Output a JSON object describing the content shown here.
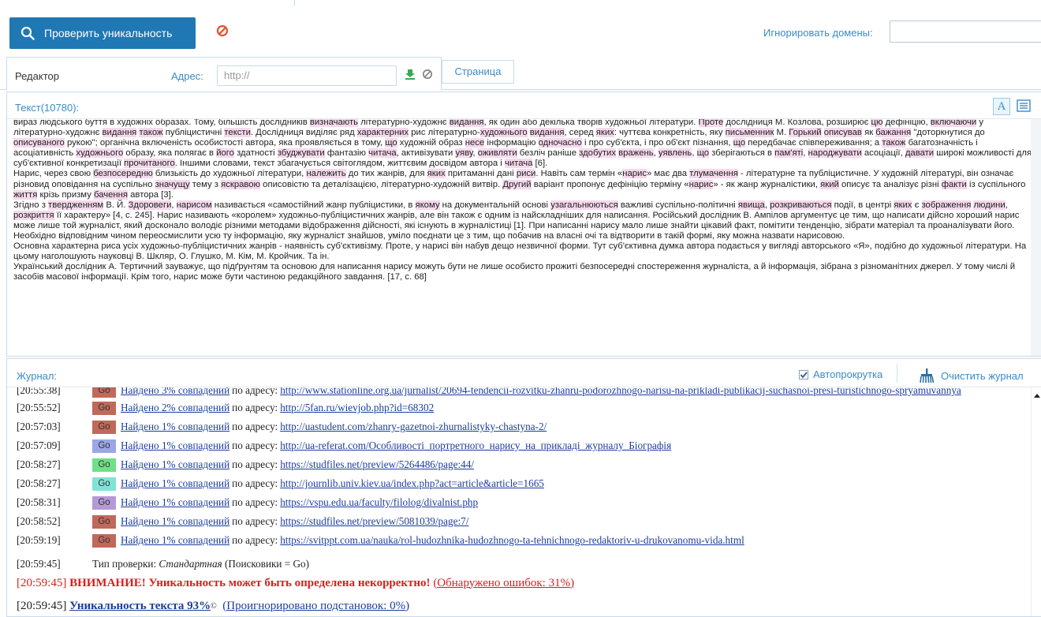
{
  "toolbar": {
    "check_label": "Проверить уникальность",
    "ignore_domains_label": "Игнорировать домены:",
    "ignore_domains_value": ""
  },
  "editor": {
    "tab_label": "Редактор",
    "address_label": "Адрес:",
    "address_placeholder": "http://",
    "page_tab_label": "Страница"
  },
  "text_panel": {
    "title": "Текст(10780):",
    "font_icon_glyph": "A"
  },
  "journal": {
    "title": "Журнал:",
    "autoscroll_label": "Автопрокрутка",
    "autoscroll_checked": true,
    "clear_label": "Очистить журнал",
    "match_prefix_by": "по адресу:",
    "rows": [
      {
        "time": "[20:55:38]",
        "go": "Go",
        "go_color": "#c0695a",
        "match": "Найдено 3% совпадений",
        "url": "http://www.stationline.org.ua/jurnalist/20694-tendencii-rozvitku-zhanru-podorozhnogo-narisu-na-prikladi-publikacij-suchasnoi-presi-turistichnogo-spryamuvannya"
      },
      {
        "time": "[20:55:52]",
        "go": "Go",
        "go_color": "#c0695a",
        "match": "Найдено 2% совпадений",
        "url": "http://5fan.ru/wievjob.php?id=68302"
      },
      {
        "time": "[20:57:03]",
        "go": "Go",
        "go_color": "#c0695a",
        "match": "Найдено 1% совпадений",
        "url": "http://uastudent.com/zhanry-gazetnoi-zhurnalistyky-chastyna-2/"
      },
      {
        "time": "[20:57:09]",
        "go": "Go",
        "go_color": "#9aa6e6",
        "match": "Найдено 1% совпадений",
        "url": "http://ua-referat.com/Особливості_портретного_нарису_на_прикладі_журналу_Біографія"
      },
      {
        "time": "[20:58:27]",
        "go": "Go",
        "go_color": "#6fe08a",
        "match": "Найдено 1% совпадений",
        "url": "https://studfiles.net/preview/5264486/page:44/"
      },
      {
        "time": "[20:58:27]",
        "go": "Go",
        "go_color": "#7fe3d6",
        "match": "Найдено 1% совпадений",
        "url": "http://journlib.univ.kiev.ua/index.php?act=article&article=1665"
      },
      {
        "time": "[20:58:31]",
        "go": "Go",
        "go_color": "#b59ad6",
        "match": "Найдено 1% совпадений",
        "url": "https://vspu.edu.ua/faculty/filolog/divalnist.php"
      },
      {
        "time": "[20:58:52]",
        "go": "Go",
        "go_color": "#c0695a",
        "match": "Найдено 1% совпадений",
        "url": "https://studfiles.net/preview/5081039/page:7/"
      },
      {
        "time": "[20:59:19]",
        "go": "Go",
        "go_color": "#c0695a",
        "match": "Найдено 1% совпадений",
        "url": "https://svitppt.com.ua/nauka/rol-hudozhnika-hudozhnogo-ta-tehnichnogo-redaktoriv-u-drukovanomu-vida.html"
      }
    ],
    "check_type": {
      "time": "[20:59:45]",
      "label": "Тип проверки:",
      "value": "Стандартная",
      "suffix": "(Поисковики = Go)"
    },
    "warning": {
      "time": "[20:59:45]",
      "text": "ВНИМАНИЕ! Уникальность может быть определена некорректно!",
      "link": "(Обнаружено ошибок: 31%)"
    },
    "uniqueness": {
      "time": "[20:59:45]",
      "text": "Уникальность текста 93%",
      "sup": "©",
      "link": "(Проигнорировано подстановок: 0%)"
    }
  },
  "colors": {
    "accent": "#1f78b4",
    "link_blue": "#3a8bc7",
    "warning_red": "#d61f1f",
    "highlight_pink": "#f5d9ec"
  }
}
